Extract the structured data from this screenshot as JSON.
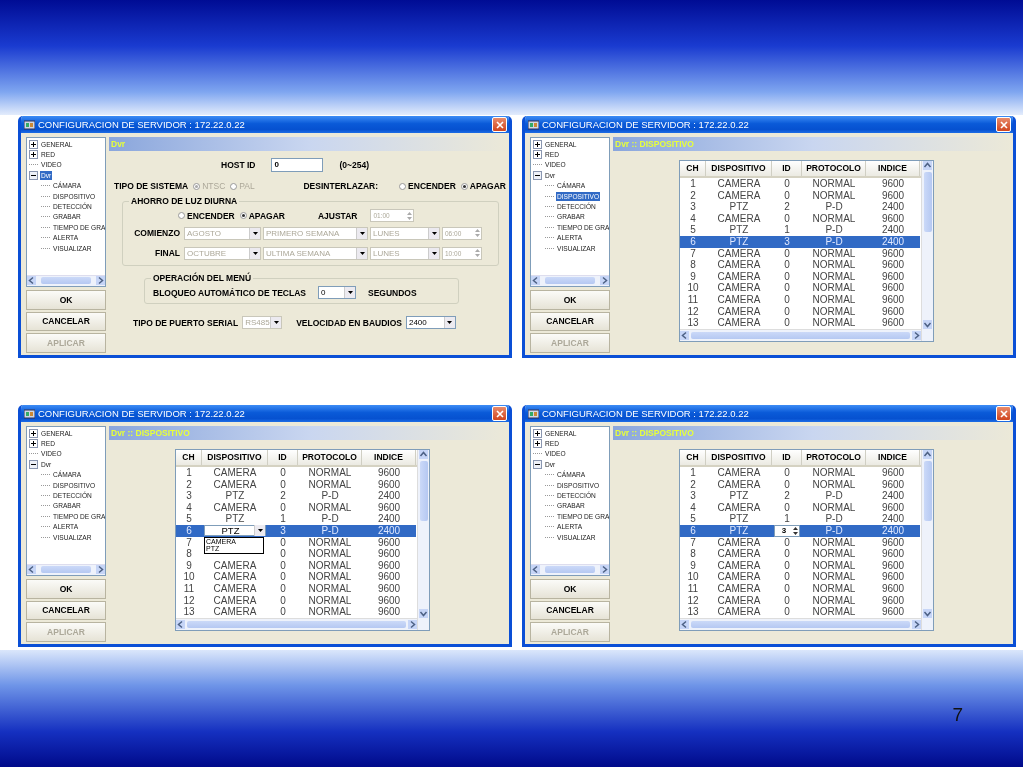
{
  "windows": [
    {
      "title": "CONFIGURACION DE SERVIDOR : 172.22.0.22",
      "tree": [
        {
          "label": "GENERAL",
          "expanded": false,
          "selected": false
        },
        {
          "label": "RED",
          "expanded": false,
          "selected": false
        },
        {
          "label": "VIDEO",
          "selected": false
        },
        {
          "label": "Dvr",
          "expanded": true,
          "selected": true,
          "children": [
            {
              "label": "CÁMARA",
              "selected": false
            },
            {
              "label": "DISPOSITIVO",
              "selected": false
            },
            {
              "label": "DETECCIÓN",
              "selected": false
            },
            {
              "label": "GRABAR",
              "selected": false
            },
            {
              "label": "TIEMPO DE GRA",
              "selected": false
            },
            {
              "label": "ALERTA",
              "selected": false
            },
            {
              "label": "VISUALIZAR",
              "selected": false
            }
          ]
        }
      ],
      "buttons": [
        {
          "label": "OK",
          "disabled": false
        },
        {
          "label": "CANCELAR",
          "disabled": false
        },
        {
          "label": "APLICAR",
          "disabled": true
        }
      ],
      "panel_title": "Dvr",
      "kind": "form",
      "form": {
        "host_id": {
          "label": "HOST ID",
          "value": "0",
          "range": "(0~254)"
        },
        "system_type": {
          "label": "TIPO DE SISTEMA",
          "disabled": true,
          "options": [
            {
              "label": "NTSC",
              "selected": true
            },
            {
              "label": "PAL",
              "selected": false
            }
          ]
        },
        "deinterlace": {
          "label": "DESINTERLAZAR:",
          "disabled": false,
          "options": [
            {
              "label": "ENCENDER",
              "selected": false
            },
            {
              "label": "APAGAR",
              "selected": true
            }
          ]
        },
        "daylight": {
          "title": "AHORRO DE LUZ DIURNA",
          "options": [
            {
              "label": "ENCENDER",
              "selected": false
            },
            {
              "label": "APAGAR",
              "selected": true
            }
          ],
          "adjust": {
            "label": "AJUSTAR",
            "value": "01:00",
            "disabled": true
          },
          "rows": [
            {
              "label": "COMIENZO",
              "selects": [
                "AGOSTO",
                "PRIMERO SEMANA",
                "LUNES"
              ],
              "time": "06:00",
              "disabled": true
            },
            {
              "label": "FINAL",
              "selects": [
                "OCTUBRE",
                "ULTIMA SEMANA",
                "LUNES"
              ],
              "time": "10:00",
              "disabled": true
            }
          ]
        },
        "menu": {
          "title": "OPERACIÓN DEL MENÚ",
          "label": "BLOQUEO AUTOMÁTICO DE TECLAS",
          "value": "0",
          "unit": "SEGUNDOS"
        },
        "serial": {
          "label": "TIPO DE PUERTO SERIAL",
          "value": "RS485",
          "disabled": true
        },
        "baud": {
          "label": "VELOCIDAD EN BAUDIOS",
          "value": "2400",
          "disabled": false
        }
      }
    },
    {
      "title": "CONFIGURACION DE SERVIDOR : 172.22.0.22",
      "tree": [
        {
          "label": "GENERAL",
          "expanded": false,
          "selected": false
        },
        {
          "label": "RED",
          "expanded": false,
          "selected": false
        },
        {
          "label": "VIDEO",
          "selected": false
        },
        {
          "label": "Dvr",
          "expanded": true,
          "selected": false,
          "children": [
            {
              "label": "CÁMARA",
              "selected": false
            },
            {
              "label": "DISPOSITIVO",
              "selected": true
            },
            {
              "label": "DETECCIÓN",
              "selected": false
            },
            {
              "label": "GRABAR",
              "selected": false
            },
            {
              "label": "TIEMPO DE GRA",
              "selected": false
            },
            {
              "label": "ALERTA",
              "selected": false
            },
            {
              "label": "VISUALIZAR",
              "selected": false
            }
          ]
        }
      ],
      "buttons": [
        {
          "label": "OK",
          "disabled": false
        },
        {
          "label": "CANCELAR",
          "disabled": false
        },
        {
          "label": "APLICAR",
          "disabled": true
        }
      ],
      "panel_title": "Dvr :: DISPOSITIVO",
      "kind": "table",
      "table": {
        "columns": [
          "CH",
          "DISPOSITIVO",
          "ID",
          "PROTOCOLO",
          "INDICE"
        ],
        "rows": [
          {
            "cells": [
              "1",
              "CAMERA",
              "0",
              "NORMAL",
              "9600"
            ],
            "selected": false
          },
          {
            "cells": [
              "2",
              "CAMERA",
              "0",
              "NORMAL",
              "9600"
            ],
            "selected": false
          },
          {
            "cells": [
              "3",
              "PTZ",
              "2",
              "P-D",
              "2400"
            ],
            "selected": false
          },
          {
            "cells": [
              "4",
              "CAMERA",
              "0",
              "NORMAL",
              "9600"
            ],
            "selected": false
          },
          {
            "cells": [
              "5",
              "PTZ",
              "1",
              "P-D",
              "2400"
            ],
            "selected": false
          },
          {
            "cells": [
              "6",
              "PTZ",
              "3",
              "P-D",
              "2400"
            ],
            "selected": true
          },
          {
            "cells": [
              "7",
              "CAMERA",
              "0",
              "NORMAL",
              "9600"
            ],
            "selected": false
          },
          {
            "cells": [
              "8",
              "CAMERA",
              "0",
              "NORMAL",
              "9600"
            ],
            "selected": false
          },
          {
            "cells": [
              "9",
              "CAMERA",
              "0",
              "NORMAL",
              "9600"
            ],
            "selected": false
          },
          {
            "cells": [
              "10",
              "CAMERA",
              "0",
              "NORMAL",
              "9600"
            ],
            "selected": false
          },
          {
            "cells": [
              "11",
              "CAMERA",
              "0",
              "NORMAL",
              "9600"
            ],
            "selected": false
          },
          {
            "cells": [
              "12",
              "CAMERA",
              "0",
              "NORMAL",
              "9600"
            ],
            "selected": false
          },
          {
            "cells": [
              "13",
              "CAMERA",
              "0",
              "NORMAL",
              "9600"
            ],
            "selected": false
          }
        ]
      }
    },
    {
      "title": "CONFIGURACION DE SERVIDOR : 172.22.0.22",
      "tree": [
        {
          "label": "GENERAL",
          "expanded": false,
          "selected": false
        },
        {
          "label": "RED",
          "expanded": false,
          "selected": false
        },
        {
          "label": "VIDEO",
          "selected": false
        },
        {
          "label": "Dvr",
          "expanded": true,
          "selected": false,
          "children": [
            {
              "label": "CÁMARA",
              "selected": false
            },
            {
              "label": "DISPOSITIVO",
              "selected": false
            },
            {
              "label": "DETECCIÓN",
              "selected": false
            },
            {
              "label": "GRABAR",
              "selected": false
            },
            {
              "label": "TIEMPO DE GRA",
              "selected": false
            },
            {
              "label": "ALERTA",
              "selected": false
            },
            {
              "label": "VISUALIZAR",
              "selected": false
            }
          ]
        }
      ],
      "buttons": [
        {
          "label": "OK",
          "disabled": false
        },
        {
          "label": "CANCELAR",
          "disabled": false
        },
        {
          "label": "APLICAR",
          "disabled": true
        }
      ],
      "panel_title": "Dvr :: DISPOSITIVO",
      "kind": "table",
      "table": {
        "columns": [
          "CH",
          "DISPOSITIVO",
          "ID",
          "PROTOCOLO",
          "INDICE"
        ],
        "rows": [
          {
            "cells": [
              "1",
              "CAMERA",
              "0",
              "NORMAL",
              "9600"
            ],
            "selected": false
          },
          {
            "cells": [
              "2",
              "CAMERA",
              "0",
              "NORMAL",
              "9600"
            ],
            "selected": false
          },
          {
            "cells": [
              "3",
              "PTZ",
              "2",
              "P-D",
              "2400"
            ],
            "selected": false
          },
          {
            "cells": [
              "4",
              "CAMERA",
              "0",
              "NORMAL",
              "9600"
            ],
            "selected": false
          },
          {
            "cells": [
              "5",
              "PTZ",
              "1",
              "P-D",
              "2400"
            ],
            "selected": false
          },
          {
            "cells": [
              "6",
              "PTZ",
              "3",
              "P-D",
              "2400"
            ],
            "selected": true,
            "editing": {
              "kind": "dropdown",
              "options": [
                "CAMERA",
                "PTZ"
              ]
            }
          },
          {
            "cells": [
              "7",
              null,
              "0",
              "NORMAL",
              "9600"
            ],
            "selected": false
          },
          {
            "cells": [
              "8",
              null,
              "0",
              "NORMAL",
              "9600"
            ],
            "selected": false
          },
          {
            "cells": [
              "9",
              "CAMERA",
              "0",
              "NORMAL",
              "9600"
            ],
            "selected": false
          },
          {
            "cells": [
              "10",
              "CAMERA",
              "0",
              "NORMAL",
              "9600"
            ],
            "selected": false
          },
          {
            "cells": [
              "11",
              "CAMERA",
              "0",
              "NORMAL",
              "9600"
            ],
            "selected": false
          },
          {
            "cells": [
              "12",
              "CAMERA",
              "0",
              "NORMAL",
              "9600"
            ],
            "selected": false
          },
          {
            "cells": [
              "13",
              "CAMERA",
              "0",
              "NORMAL",
              "9600"
            ],
            "selected": false
          }
        ]
      }
    },
    {
      "title": "CONFIGURACION DE SERVIDOR : 172.22.0.22",
      "tree": [
        {
          "label": "GENERAL",
          "expanded": false,
          "selected": false
        },
        {
          "label": "RED",
          "expanded": false,
          "selected": false
        },
        {
          "label": "VIDEO",
          "selected": false
        },
        {
          "label": "Dvr",
          "expanded": true,
          "selected": false,
          "children": [
            {
              "label": "CÁMARA",
              "selected": false
            },
            {
              "label": "DISPOSITIVO",
              "selected": false
            },
            {
              "label": "DETECCIÓN",
              "selected": false
            },
            {
              "label": "GRABAR",
              "selected": false
            },
            {
              "label": "TIEMPO DE GRA",
              "selected": false
            },
            {
              "label": "ALERTA",
              "selected": false
            },
            {
              "label": "VISUALIZAR",
              "selected": false
            }
          ]
        }
      ],
      "buttons": [
        {
          "label": "OK",
          "disabled": false
        },
        {
          "label": "CANCELAR",
          "disabled": false
        },
        {
          "label": "APLICAR",
          "disabled": true
        }
      ],
      "panel_title": "Dvr :: DISPOSITIVO",
      "kind": "table",
      "table": {
        "columns": [
          "CH",
          "DISPOSITIVO",
          "ID",
          "PROTOCOLO",
          "INDICE"
        ],
        "rows": [
          {
            "cells": [
              "1",
              "CAMERA",
              "0",
              "NORMAL",
              "9600"
            ],
            "selected": false
          },
          {
            "cells": [
              "2",
              "CAMERA",
              "0",
              "NORMAL",
              "9600"
            ],
            "selected": false
          },
          {
            "cells": [
              "3",
              "PTZ",
              "2",
              "P-D",
              "2400"
            ],
            "selected": false
          },
          {
            "cells": [
              "4",
              "CAMERA",
              "0",
              "NORMAL",
              "9600"
            ],
            "selected": false
          },
          {
            "cells": [
              "5",
              "PTZ",
              "1",
              "P-D",
              "2400"
            ],
            "selected": false
          },
          {
            "cells": [
              "6",
              "PTZ",
              "3",
              "P-D",
              "2400"
            ],
            "selected": true,
            "editing": {
              "kind": "spin"
            }
          },
          {
            "cells": [
              "7",
              "CAMERA",
              "0",
              "NORMAL",
              "9600"
            ],
            "selected": false
          },
          {
            "cells": [
              "8",
              "CAMERA",
              "0",
              "NORMAL",
              "9600"
            ],
            "selected": false
          },
          {
            "cells": [
              "9",
              "CAMERA",
              "0",
              "NORMAL",
              "9600"
            ],
            "selected": false
          },
          {
            "cells": [
              "10",
              "CAMERA",
              "0",
              "NORMAL",
              "9600"
            ],
            "selected": false
          },
          {
            "cells": [
              "11",
              "CAMERA",
              "0",
              "NORMAL",
              "9600"
            ],
            "selected": false
          },
          {
            "cells": [
              "12",
              "CAMERA",
              "0",
              "NORMAL",
              "9600"
            ],
            "selected": false
          },
          {
            "cells": [
              "13",
              "CAMERA",
              "0",
              "NORMAL",
              "9600"
            ],
            "selected": false
          }
        ]
      }
    }
  ],
  "page_number": "7"
}
